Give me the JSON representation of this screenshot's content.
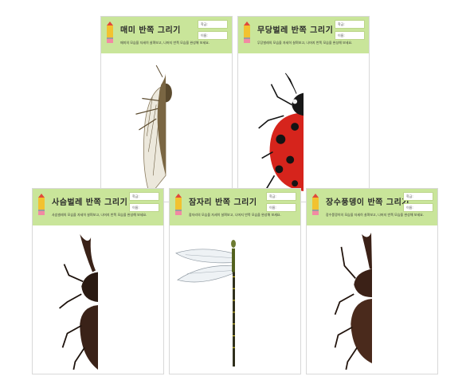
{
  "worksheets": [
    {
      "title": "매미 반쪽 그리기",
      "insect_icon": "cicada-half"
    },
    {
      "title": "무당벌레 반쪽 그리기",
      "insect_icon": "ladybug-half"
    },
    {
      "title": "사슴벌레 반쪽 그리기",
      "insect_icon": "stag-beetle-half"
    },
    {
      "title": "잠자리 반쪽 그리기",
      "insect_icon": "dragonfly-half"
    },
    {
      "title": "장수풍뎅이 반쪽 그리기",
      "insect_icon": "rhinoceros-beetle-half"
    }
  ],
  "fields": {
    "class": "학급:",
    "name": "이름:"
  },
  "instructions": [
    "매미의 모습을 자세히 살펴보고, 나머지 반쪽 모습을 완성해 보세요.",
    "무당벌레의 모습을 자세히 살펴보고, 나머지 반쪽 모습을 완성해 보세요.",
    "사슴벌레의 모습을 자세히 살펴보고, 나머지 반쪽 모습을 완성해 보세요.",
    "잠자리의 모습을 자세히 살펴보고, 나머지 반쪽 모습을 완성해 보세요.",
    "장수풍뎅이의 모습을 자세히 살펴보고, 나머지 반쪽 모습을 완성해 보세요."
  ],
  "colors": {
    "header": "#c9e59a",
    "pencil_body": "#f2c230",
    "pencil_tip": "#e04a3a"
  }
}
